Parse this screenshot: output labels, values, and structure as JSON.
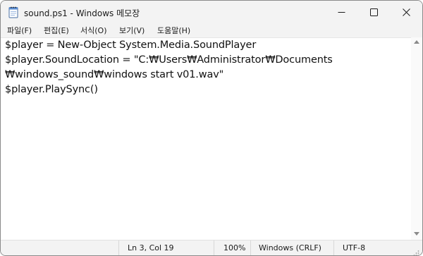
{
  "window": {
    "title": "sound.ps1 - Windows 메모장",
    "controls": {
      "minimize": "minimize",
      "maximize": "maximize",
      "close": "close"
    }
  },
  "menu": {
    "items": [
      {
        "label": "파일(F)"
      },
      {
        "label": "편집(E)"
      },
      {
        "label": "서식(O)"
      },
      {
        "label": "보기(V)"
      },
      {
        "label": "도움말(H)"
      }
    ]
  },
  "editor": {
    "lines": [
      "$player = New-Object System.Media.SoundPlayer",
      "$player.SoundLocation = \"C:₩Users₩Administrator₩Documents",
      "₩windows_sound₩windows start v01.wav\"",
      "$player.PlaySync()"
    ]
  },
  "status": {
    "position": "Ln 3, Col 19",
    "zoom": "100%",
    "line_ending": "Windows (CRLF)",
    "encoding": "UTF-8"
  },
  "icons": {
    "app": "notepad-icon",
    "minimize": "minimize-icon",
    "maximize": "maximize-icon",
    "close": "close-icon"
  }
}
